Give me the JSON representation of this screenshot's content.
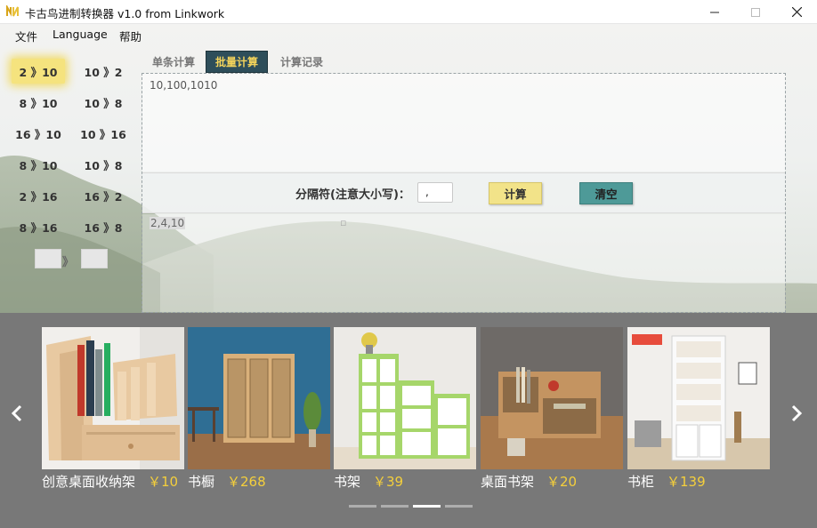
{
  "window": {
    "title": "卡古鸟进制转换器 v1.0 from Linkwork"
  },
  "menu": [
    "文件",
    "Language",
    "帮助"
  ],
  "converters": [
    "2 》10",
    "10 》2",
    "8 》10",
    "10 》8",
    "16 》10",
    "10 》16",
    "8 》10",
    "10 》8",
    "2 》16",
    "16 》2",
    "8 》16",
    "16 》8"
  ],
  "active_converter": "2 》10",
  "custom_arrow": "》",
  "tabs": [
    "单条计算",
    "批量计算",
    "计算记录"
  ],
  "active_tab": "批量计算",
  "input_text": "10,100,1010",
  "separator_label": "分隔符(注意大小写)：",
  "separator_value": ",",
  "calc_button": "计算",
  "clear_button": "清空",
  "output_text": "2,4,10",
  "ads": [
    {
      "name": "创意桌面收纳架",
      "price": "￥10"
    },
    {
      "name": "书橱",
      "price": "￥268"
    },
    {
      "name": "书架",
      "price": "￥39"
    },
    {
      "name": "桌面书架",
      "price": "￥20"
    },
    {
      "name": "书柜",
      "price": "￥139"
    }
  ],
  "carousel": {
    "prev_icon": "chevron-left-icon",
    "next_icon": "chevron-right-icon",
    "dots": 4,
    "active_dot": 3
  },
  "colors": {
    "accent_yellow": "#f5e37e",
    "active_tab_bg": "#2e4e5a",
    "active_tab_text": "#f3d35b",
    "clear_button": "#4e9a98",
    "price": "#f4cf3c",
    "ad_bar": "#787878"
  }
}
